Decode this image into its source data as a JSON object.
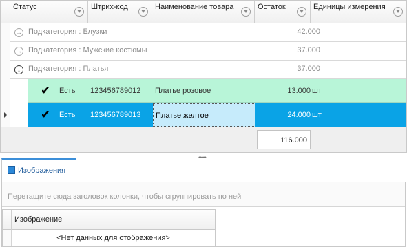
{
  "grid": {
    "columns": [
      {
        "label": "Статус"
      },
      {
        "label": "Штрих-код"
      },
      {
        "label": "Наименование товара"
      },
      {
        "label": "Остаток"
      },
      {
        "label": "Единицы измерения"
      }
    ],
    "groups": [
      {
        "label": "Подкатегория : Блузки",
        "sum": "42.000",
        "expanded": false
      },
      {
        "label": "Подкатегория : Мужские костюмы",
        "sum": "37.000",
        "expanded": false
      },
      {
        "label": "Подкатегория : Платья",
        "sum": "37.000",
        "expanded": true
      }
    ],
    "rows": [
      {
        "check": "✔",
        "status": "Есть",
        "barcode": "123456789012",
        "name": "Платье розовое",
        "qty": "13.000",
        "unit": "шт"
      },
      {
        "check": "✔",
        "status": "Есть",
        "barcode": "123456789013",
        "name": "Платье желтое",
        "qty": "24.000",
        "unit": "шт"
      }
    ],
    "total": "116.000"
  },
  "splitter": "•••••",
  "tab": {
    "label": "Изображения"
  },
  "panel": {
    "group_hint": "Перетащите сюда заголовок колонки, чтобы сгруппировать по ней",
    "column": "Изображение",
    "no_data": "<Нет данных для отображения>"
  }
}
